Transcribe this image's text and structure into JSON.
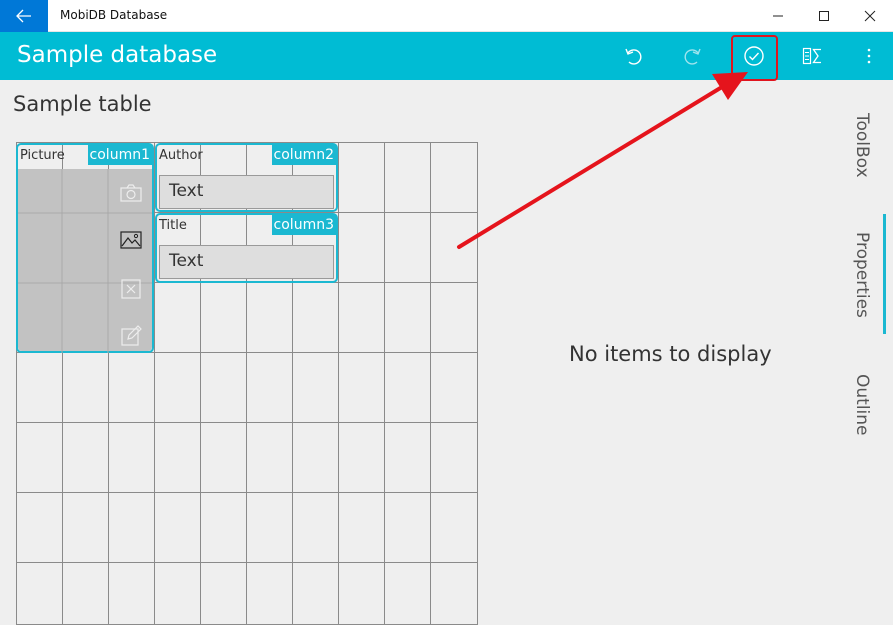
{
  "window": {
    "title": "MobiDB Database"
  },
  "appbar": {
    "title": "Sample database",
    "commands": [
      "undo-icon",
      "redo-icon",
      "checkmark-icon",
      "formula-icon",
      "more-icon"
    ]
  },
  "table": {
    "title": "Sample table",
    "fields": [
      {
        "label": "Picture",
        "column": "column1"
      },
      {
        "label": "Author",
        "column": "column2",
        "value": "Text"
      },
      {
        "label": "Title",
        "column": "column3",
        "value": "Text"
      }
    ]
  },
  "panel": {
    "empty_message": "No items to display",
    "tabs": [
      "ToolBox",
      "Properties",
      "Outline"
    ]
  },
  "colors": {
    "accent": "#00bcd4",
    "back_button": "#0078d7",
    "highlight": "#e0141e"
  }
}
